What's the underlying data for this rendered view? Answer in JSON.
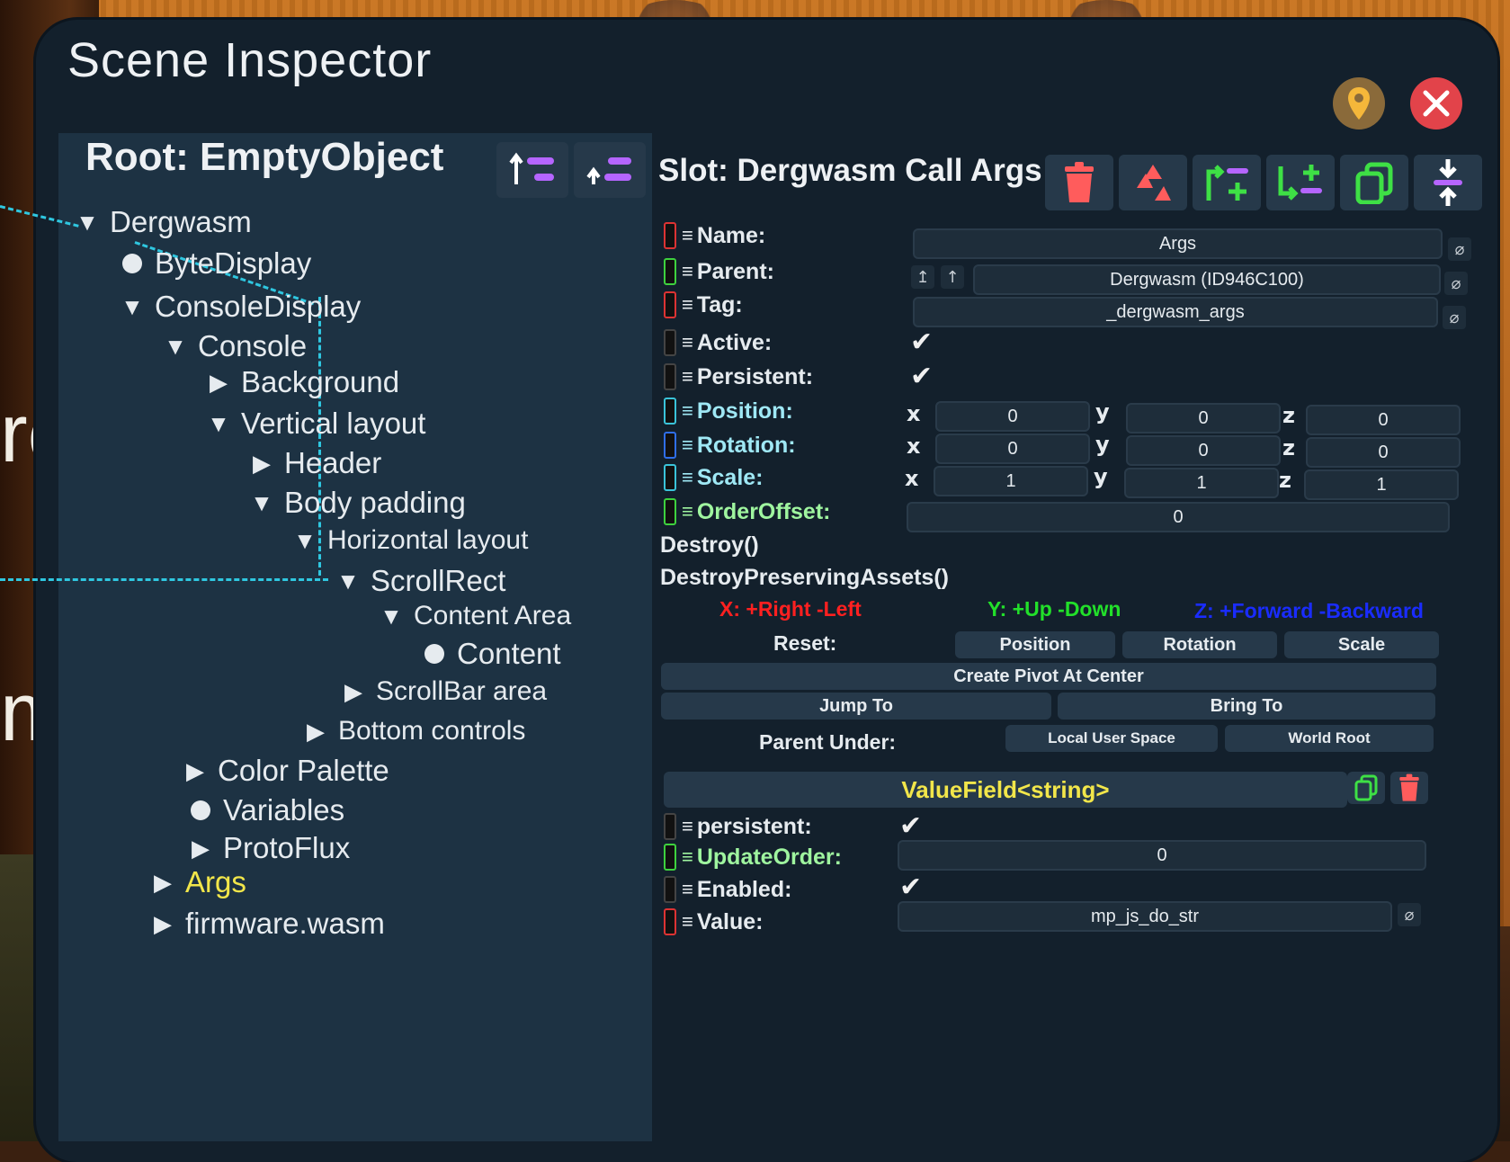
{
  "window": {
    "title": "Scene Inspector"
  },
  "hierarchy": {
    "root_label": "Root: EmptyObject",
    "items": [
      {
        "label": "Dergwasm",
        "state": "expanded"
      },
      {
        "label": "ByteDisplay",
        "state": "leaf"
      },
      {
        "label": "ConsoleDisplay",
        "state": "expanded"
      },
      {
        "label": "Console",
        "state": "expanded"
      },
      {
        "label": "Background",
        "state": "collapsed"
      },
      {
        "label": "Vertical layout",
        "state": "expanded"
      },
      {
        "label": "Header",
        "state": "collapsed"
      },
      {
        "label": "Body padding",
        "state": "expanded"
      },
      {
        "label": "Horizontal layout",
        "state": "expanded"
      },
      {
        "label": "ScrollRect",
        "state": "expanded"
      },
      {
        "label": "Content Area",
        "state": "expanded"
      },
      {
        "label": "Content",
        "state": "leaf"
      },
      {
        "label": "ScrollBar area",
        "state": "collapsed"
      },
      {
        "label": "Bottom controls",
        "state": "collapsed"
      },
      {
        "label": "Color Palette",
        "state": "collapsed"
      },
      {
        "label": "Variables",
        "state": "leaf"
      },
      {
        "label": "ProtoFlux",
        "state": "collapsed"
      },
      {
        "label": "Args",
        "state": "collapsed",
        "selected": true
      },
      {
        "label": "firmware.wasm",
        "state": "collapsed"
      }
    ]
  },
  "slot": {
    "title": "Slot: Dergwasm Call Args",
    "fields": {
      "name_label": "Name:",
      "name_value": "Args",
      "parent_label": "Parent:",
      "parent_value": "Dergwasm (ID946C100)",
      "tag_label": "Tag:",
      "tag_value": "_dergwasm_args",
      "active_label": "Active:",
      "persistent_label": "Persistent:",
      "position_label": "Position:",
      "rotation_label": "Rotation:",
      "scale_label": "Scale:",
      "orderoffset_label": "OrderOffset:",
      "orderoffset_value": "0"
    },
    "axes": {
      "x": "x",
      "y": "y",
      "z": "z"
    },
    "position": [
      "0",
      "0",
      "0"
    ],
    "rotation": [
      "0",
      "0",
      "0"
    ],
    "scale": [
      "1",
      "1",
      "1"
    ],
    "methods": [
      "Destroy()",
      "DestroyPreservingAssets()"
    ],
    "axis_legend": {
      "x": "X: +Right -Left",
      "y": "Y: +Up -Down",
      "z": "Z: +Forward -Backward"
    },
    "reset_label": "Reset:",
    "reset_buttons": [
      "Position",
      "Rotation",
      "Scale"
    ],
    "create_pivot": "Create Pivot At Center",
    "jump_to": "Jump To",
    "bring_to": "Bring To",
    "parent_under_label": "Parent Under:",
    "parent_under_buttons": [
      "Local User Space",
      "World Root"
    ]
  },
  "component": {
    "title": "ValueField<string>",
    "fields": {
      "persistent_label": "persistent:",
      "updateorder_label": "UpdateOrder:",
      "updateorder_value": "0",
      "enabled_label": "Enabled:",
      "value_label": "Value:",
      "value_value": "mp_js_do_str"
    }
  },
  "background_text": {
    "glyph_a": "rc",
    "glyph_b": "m"
  },
  "colors": {
    "panel": "#13202c",
    "hierarchy_bg": "#1d3243",
    "selected_item": "#f2e64a",
    "x_axis": "#ff2020",
    "y_axis": "#22e02a",
    "z_axis": "#1a2cff",
    "delete": "#e2434a"
  },
  "icons": [
    "locate-icon",
    "close-icon",
    "sort-up-icon",
    "sort-down-icon",
    "trash-icon",
    "recycle-icon",
    "insert-parent-icon",
    "insert-child-icon",
    "duplicate-icon",
    "move-to-icon",
    "null-icon",
    "check-icon"
  ]
}
